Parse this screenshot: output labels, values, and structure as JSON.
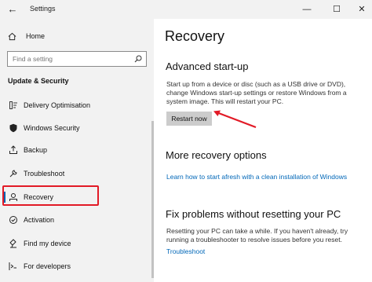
{
  "window": {
    "title": "Settings",
    "back_glyph": "←",
    "minimize_glyph": "—",
    "maximize_glyph": "☐",
    "close_glyph": "✕"
  },
  "sidebar": {
    "home_label": "Home",
    "search_placeholder": "Find a setting",
    "section_title": "Update & Security",
    "items": [
      {
        "label": "Delivery Optimisation",
        "icon": "delivery-optimisation-icon"
      },
      {
        "label": "Windows Security",
        "icon": "shield-icon"
      },
      {
        "label": "Backup",
        "icon": "backup-icon"
      },
      {
        "label": "Troubleshoot",
        "icon": "wrench-icon"
      },
      {
        "label": "Recovery",
        "icon": "recovery-icon"
      },
      {
        "label": "Activation",
        "icon": "activation-icon"
      },
      {
        "label": "Find my device",
        "icon": "find-device-icon"
      },
      {
        "label": "For developers",
        "icon": "developer-icon"
      }
    ],
    "selected_index": 4
  },
  "main": {
    "title": "Recovery",
    "advanced": {
      "heading": "Advanced start-up",
      "description": "Start up from a device or disc (such as a USB drive or DVD), change Windows start-up settings or restore Windows from a system image. This will restart your PC.",
      "button_label": "Restart now"
    },
    "more": {
      "heading": "More recovery options",
      "link": "Learn how to start afresh with a clean installation of Windows"
    },
    "fix": {
      "heading": "Fix problems without resetting your PC",
      "description": "Resetting your PC can take a while. If you haven't already, try running a troubleshooter to resolve issues before you reset.",
      "link": "Troubleshoot"
    }
  },
  "colors": {
    "accent": "#0063b1",
    "link": "#0067b8",
    "highlight_annotation": "#e21a26",
    "sidebar_bg": "#f2f2f2"
  }
}
